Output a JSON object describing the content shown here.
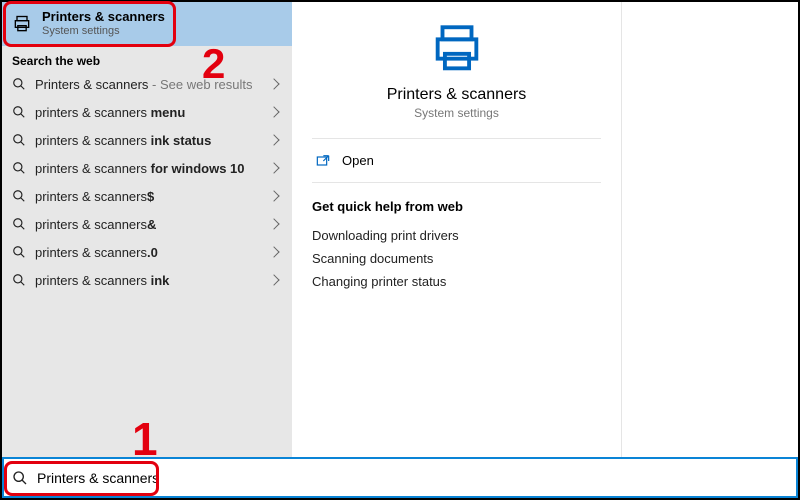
{
  "best_match": {
    "title": "Printers & scanners",
    "subtitle": "System settings"
  },
  "web_header": "Search the web",
  "suggestions": [
    {
      "prefix": "Printers & scanners",
      "bold": "",
      "hint": " - See web results",
      "first_plain": true
    },
    {
      "prefix": "printers & scanners ",
      "bold": "menu"
    },
    {
      "prefix": "printers & scanners ",
      "bold": "ink status"
    },
    {
      "prefix": "printers & scanners ",
      "bold": "for windows 10"
    },
    {
      "prefix": "printers & scanners",
      "bold": "$"
    },
    {
      "prefix": "printers & scanners",
      "bold": "&"
    },
    {
      "prefix": "printers & scanners",
      "bold": ".0"
    },
    {
      "prefix": "printers & scanners ",
      "bold": "ink"
    }
  ],
  "detail": {
    "title": "Printers & scanners",
    "subtitle": "System settings",
    "open_label": "Open",
    "help_header": "Get quick help from web",
    "help_links": [
      "Downloading print drivers",
      "Scanning documents",
      "Changing printer status"
    ]
  },
  "search": {
    "value": "Printers & scanners"
  },
  "annotations": {
    "num1": "1",
    "num2": "2"
  }
}
